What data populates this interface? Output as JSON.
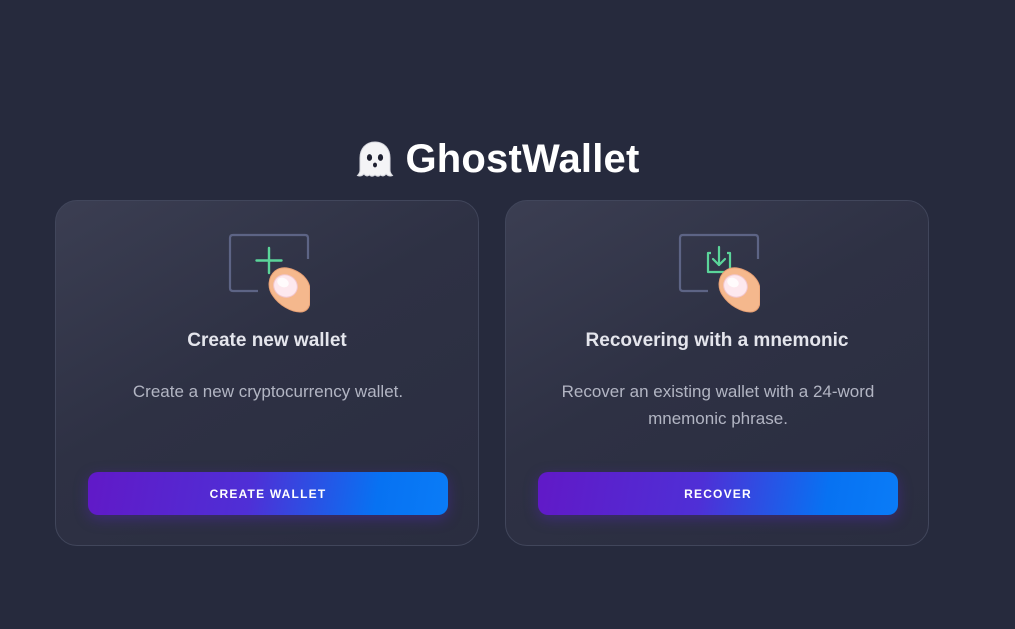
{
  "app": {
    "title": "GhostWallet",
    "logo_icon": "ghost-icon"
  },
  "cards": [
    {
      "icon": "add-wallet-tap-icon",
      "title": "Create new wallet",
      "description": "Create a new cryptocurrency wallet.",
      "button_label": "CREATE WALLET"
    },
    {
      "icon": "import-wallet-tap-icon",
      "title": "Recovering with a mnemonic",
      "description": "Recover an existing wallet with a 24-word mnemonic phrase.",
      "button_label": "RECOVER"
    }
  ],
  "colors": {
    "background": "#262a3d",
    "accent_start": "#6119c7",
    "accent_end": "#0a7cf7",
    "icon_green": "#5bd59a"
  }
}
